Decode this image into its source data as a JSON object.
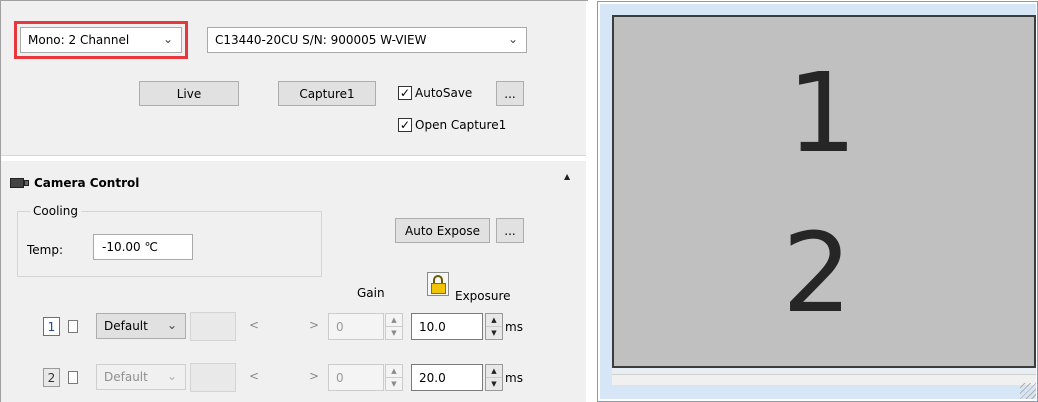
{
  "mode_select": {
    "value": "Mono: 2 Channel"
  },
  "camera_select": {
    "value": "C13440-20CU S/N: 900005 W-VIEW"
  },
  "buttons": {
    "live": "Live",
    "capture": "Capture1",
    "auto_expose": "Auto Expose",
    "more": "..."
  },
  "checkboxes": {
    "autosave": {
      "label": "AutoSave",
      "checked": true
    },
    "open_capture": {
      "label": "Open Capture1",
      "checked": true
    }
  },
  "camera_control": {
    "title": "Camera Control",
    "cooling": {
      "group_label": "Cooling",
      "temp_label": "Temp:",
      "temp_value": "-10.00 ℃"
    },
    "gain_header": "Gain",
    "exposure_header": "Exposure"
  },
  "channels": [
    {
      "number": "1",
      "preset": "Default",
      "slider_left": "<",
      "slider_right": ">",
      "gain": "0",
      "exposure": "10.0",
      "unit": "ms"
    },
    {
      "number": "2",
      "preset": "Default",
      "slider_left": "<",
      "slider_right": ">",
      "gain": "0",
      "exposure": "20.0",
      "unit": "ms"
    }
  ],
  "viewer": {
    "channel_1": "1",
    "channel_2": "2"
  },
  "colors": {
    "highlight": "#e8363d",
    "canvas": "#c0c0c0",
    "bezel": "#d7e6f7"
  },
  "icons": [
    "chevron-down-icon",
    "camera-icon",
    "collapse-arrow-icon",
    "lock-icon",
    "spin-up-icon",
    "spin-down-icon",
    "resize-grip-icon"
  ]
}
